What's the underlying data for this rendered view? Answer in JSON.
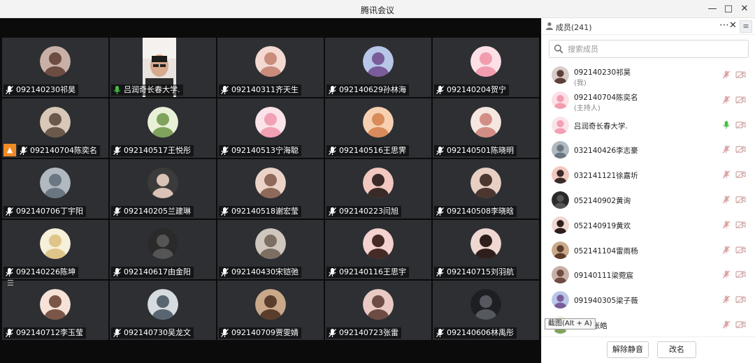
{
  "window": {
    "title": "腾讯会议"
  },
  "panel": {
    "title": "成员(241)",
    "search_placeholder": "搜索成员",
    "buttons": {
      "unmute": "解除静音",
      "rename": "改名"
    },
    "tooltip": "截图(Alt + A)"
  },
  "colors": {
    "accent_orange": "#f08a24",
    "mic_green": "#3fbf3f",
    "muted_red": "#e05050"
  },
  "tiles": [
    {
      "name": "092140230祁昊"
    },
    {
      "name": "吕润奇长春大学."
    },
    {
      "name": "092140311齐天生"
    },
    {
      "name": "092140629孙林海"
    },
    {
      "name": "092140204贺宁"
    },
    {
      "name": "092140704陈奕名"
    },
    {
      "name": "092140517王悦彤"
    },
    {
      "name": "092140513宁海聪"
    },
    {
      "name": "092140516王思霁"
    },
    {
      "name": "092140501陈晓明"
    },
    {
      "name": "092140706丁宇阳"
    },
    {
      "name": "092140205兰建琳"
    },
    {
      "name": "092140518谢宏莹"
    },
    {
      "name": "092140223闫旭"
    },
    {
      "name": "092140508李晓晗"
    },
    {
      "name": "092140226陈坤"
    },
    {
      "name": "092140617由金阳"
    },
    {
      "name": "092140430宋铠弛"
    },
    {
      "name": "092140116王思宇"
    },
    {
      "name": "092140715刘羽航"
    },
    {
      "name": "092140712李玉莹"
    },
    {
      "name": "092140730吴龙文"
    },
    {
      "name": "092140709贾雯婧"
    },
    {
      "name": "092140723张雷"
    },
    {
      "name": "092140606林禹彤"
    }
  ],
  "members": [
    {
      "name": "092140230祁昊",
      "role": "(我)"
    },
    {
      "name": "092140704陈奕名",
      "role": "(主持人)"
    },
    {
      "name": "吕润奇长春大学.",
      "role": ""
    },
    {
      "name": "032140426李志豪",
      "role": ""
    },
    {
      "name": "032141121徐嘉圻",
      "role": ""
    },
    {
      "name": "052140902黄询",
      "role": ""
    },
    {
      "name": "052140919黄欢",
      "role": ""
    },
    {
      "name": "052141104雷雨杨",
      "role": ""
    },
    {
      "name": "09140111梁菀宸",
      "role": ""
    },
    {
      "name": "091940305梁子薇",
      "role": ""
    },
    {
      "name": "0225张皓",
      "role": ""
    }
  ]
}
